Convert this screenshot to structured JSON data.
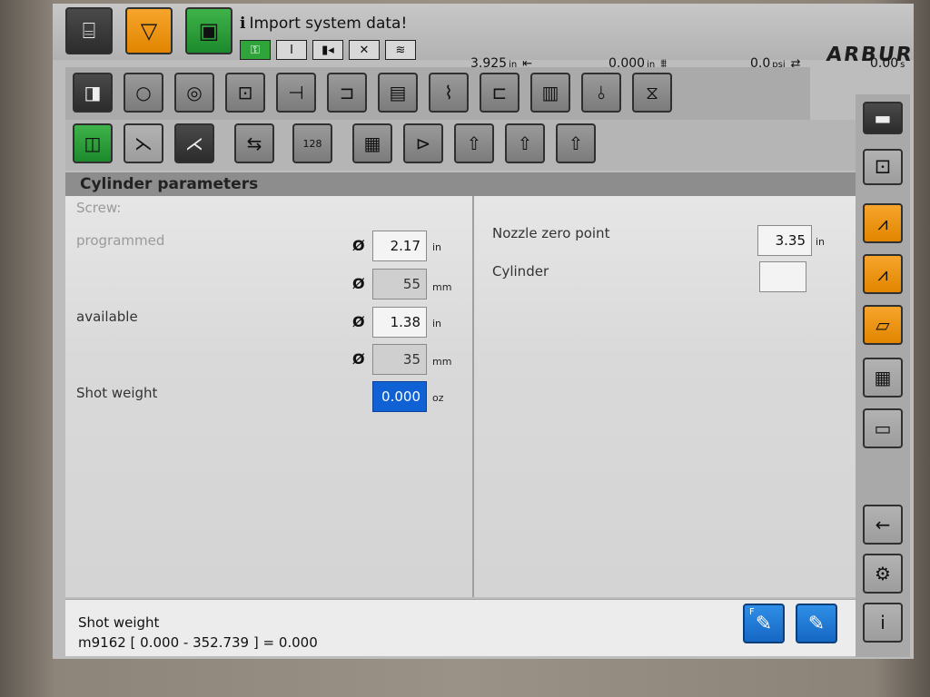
{
  "window": {
    "title_prefix": "i",
    "title": "Import system data!",
    "logo": "ARBURG"
  },
  "header_buttons": [
    {
      "name": "machine-icon",
      "glyph": "⛭"
    },
    {
      "name": "warning-triangle-icon",
      "glyph": "▽"
    },
    {
      "name": "door-icon",
      "glyph": "▣"
    }
  ],
  "status_icons": [
    "key-icon",
    "info-icon",
    "injection-icon",
    "mold-icon",
    "screw-icon"
  ],
  "readouts": [
    {
      "value": "3.925",
      "unit": "in"
    },
    {
      "value": "0.000",
      "unit": "in"
    },
    {
      "value": "0.0",
      "unit": "psi"
    },
    {
      "value": "0.00",
      "unit": "s"
    }
  ],
  "toolbar1": [
    "door-icon",
    "circle-icon",
    "spiral-icon",
    "clamp-icon",
    "ejector-icon",
    "nozzle-icon",
    "heater-icon",
    "temperature-icon",
    "cylinder-temp-icon",
    "mold-temp-icon",
    "probe-icon",
    "gripper-icon"
  ],
  "toolbar2": [
    "green-setup-icon",
    "injection-profile-icon",
    "screw-config-icon",
    "robot-icon",
    "counter-icon",
    "document-icon",
    "document-send-icon",
    "document-1-icon",
    "document-2-icon",
    "document-3-icon"
  ],
  "toolbar2_counter": "128",
  "panel": {
    "title": "Cylinder parameters",
    "screw_label": "Screw:",
    "programmed_label": "programmed",
    "available_label": "available",
    "shot_weight_label": "Shot weight",
    "diameter_symbol": "Ø",
    "programmed_in": "2.17",
    "programmed_in_unit": "in",
    "programmed_mm": "55",
    "programmed_mm_unit": "mm",
    "available_in": "1.38",
    "available_in_unit": "in",
    "available_mm": "35",
    "available_mm_unit": "mm",
    "shot_weight_value": "0.000",
    "shot_weight_unit": "oz",
    "nozzle_label": "Nozzle zero point",
    "nozzle_value": "3.35",
    "nozzle_unit": "in",
    "cylinder_label": "Cylinder",
    "cylinder_value": ""
  },
  "footer": {
    "line1": "Shot weight",
    "line2": "m9162 [ 0.000 - 352.739 ] = 0.000",
    "edit_f_label": "F"
  },
  "rightbar": [
    "palette-icon",
    "overview-icon",
    "curve-icon",
    "curve-adjust-icon",
    "protocol-icon",
    "table-icon",
    "message-icon",
    "back-icon",
    "settings-icon",
    "info-icon"
  ],
  "colors": {
    "orange": "#f39a1e",
    "green": "#2aa53a",
    "selection_blue": "#1061d4"
  }
}
